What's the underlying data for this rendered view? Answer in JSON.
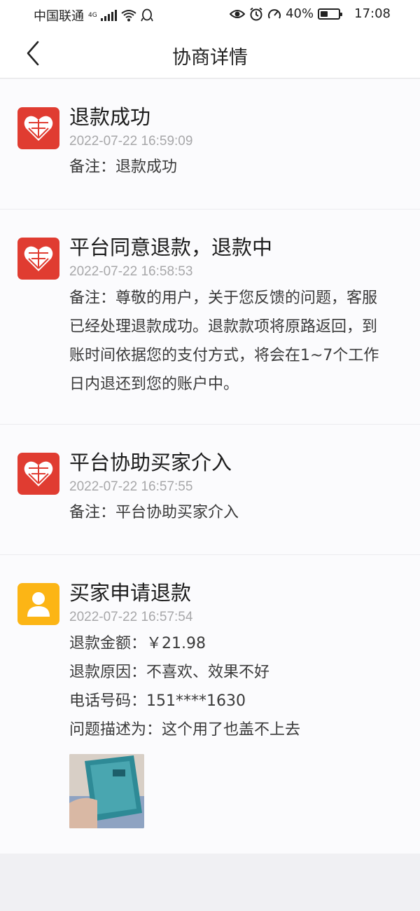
{
  "status_bar": {
    "carrier": "中国联通",
    "network": "4G",
    "battery": "40%",
    "battery_level": 0.4,
    "time": "17:08",
    "icons": [
      "signal-icon",
      "wifi-icon",
      "qq-icon",
      "eye-icon",
      "alarm-icon",
      "speedometer-icon",
      "battery-icon"
    ]
  },
  "header": {
    "title": "协商详情",
    "back_icon": "chevron-left-icon"
  },
  "entries": [
    {
      "avatar": "pinduoduo-logo",
      "title": "退款成功",
      "time": "2022-07-22 16:59:09",
      "note": "备注：退款成功"
    },
    {
      "avatar": "pinduoduo-logo",
      "title": "平台同意退款，退款中",
      "time": "2022-07-22 16:58:53",
      "note_lines": [
        "备注：尊敬的用户，关于您反馈的问题，客服",
        "已经处理退款成功。退款款项将原路返回，到",
        "账时间依据您的支付方式，将会在1~7个工作",
        "日内退还到您的账户中。"
      ]
    },
    {
      "avatar": "pinduoduo-logo",
      "title": "平台协助买家介入",
      "time": "2022-07-22 16:57:55",
      "note": "备注：平台协助买家介入"
    },
    {
      "avatar": "user-icon",
      "title": "买家申请退款",
      "time": "2022-07-22 16:57:54",
      "details": [
        "退款金额：￥21.98",
        "退款原因：不喜欢、效果不好",
        "电话号码：151****1630",
        "问题描述为：这个用了也盖不上去"
      ],
      "attachment": "photo-thumbnail"
    }
  ],
  "colors": {
    "pdd_red": "#e03c31",
    "user_yellow": "#fcb515",
    "time_gray": "#a7a7a9"
  }
}
